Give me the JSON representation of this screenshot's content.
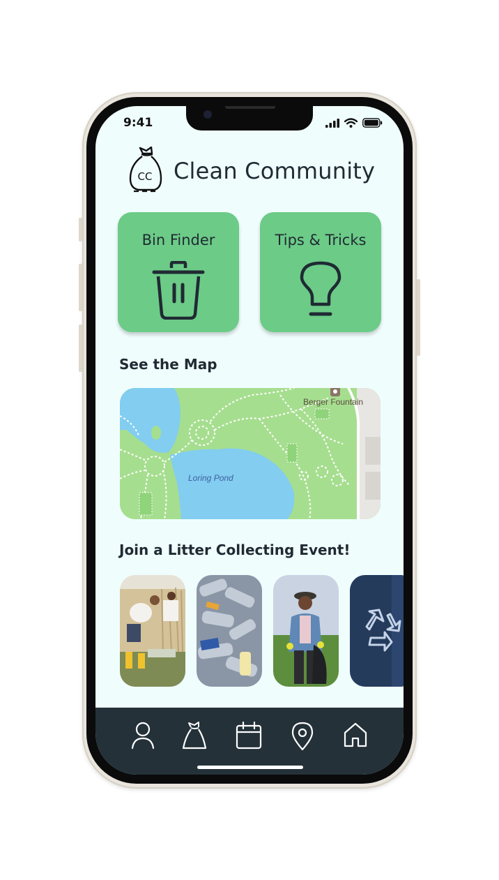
{
  "status_bar": {
    "time": "9:41"
  },
  "header": {
    "title": "Clean Community",
    "logo_text": "CC"
  },
  "cards": [
    {
      "label": "Bin Finder",
      "icon": "trash-bin-icon"
    },
    {
      "label": "Tips & Tricks",
      "icon": "lightbulb-icon"
    }
  ],
  "map_section": {
    "title": "See the Map",
    "labels": {
      "poi": "Berger Fountain",
      "water": "Loring Pond"
    }
  },
  "events_section": {
    "title": "Join a Litter Collecting Event!",
    "items": [
      {
        "image": "volunteers-picking-litter-photo"
      },
      {
        "image": "plastic-bottles-photo"
      },
      {
        "image": "volunteer-with-trash-bag-photo"
      },
      {
        "image": "recycling-symbol-photo"
      }
    ]
  },
  "nav": {
    "items": [
      {
        "icon": "profile-icon"
      },
      {
        "icon": "trash-bag-icon"
      },
      {
        "icon": "calendar-icon"
      },
      {
        "icon": "location-pin-icon"
      },
      {
        "icon": "home-icon"
      }
    ]
  },
  "colors": {
    "screen_bg": "#f0fdfd",
    "card_green": "#6ccb87",
    "text_dark": "#1f2a33",
    "navbar_bg": "#243139",
    "map_park": "#a6de8f",
    "map_water": "#82cdf0"
  }
}
